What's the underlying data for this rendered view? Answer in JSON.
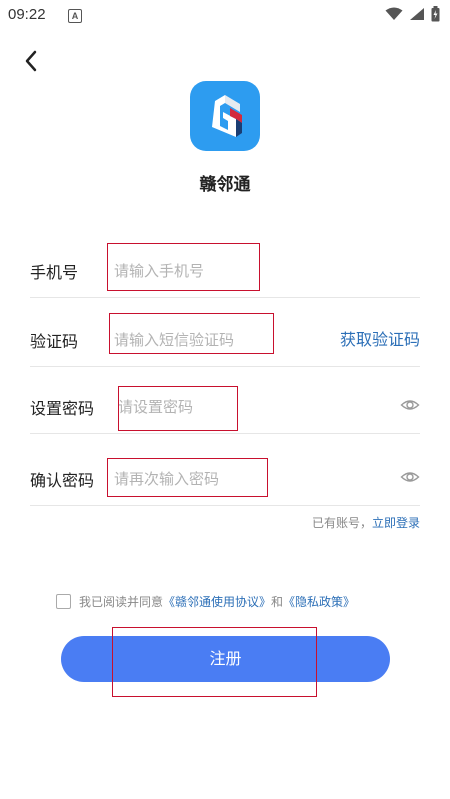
{
  "status_bar": {
    "time": "09:22",
    "notification_letter": "A"
  },
  "app": {
    "name": "赣邻通",
    "brand_color": "#2d9cf0"
  },
  "form": {
    "phone": {
      "label": "手机号",
      "placeholder": "请输入手机号",
      "value": ""
    },
    "code": {
      "label": "验证码",
      "placeholder": "请输入短信验证码",
      "value": "",
      "get_code_label": "获取验证码"
    },
    "password": {
      "label": "设置密码",
      "placeholder": "请设置密码",
      "value": ""
    },
    "confirm_password": {
      "label": "确认密码",
      "placeholder": "请再次输入密码",
      "value": ""
    }
  },
  "login_prompt": {
    "text": "已有账号，",
    "link": "立即登录"
  },
  "agreement": {
    "prefix": "我已阅读并同意",
    "terms_link": "《赣邻通使用协议》",
    "and": "和",
    "privacy_link": "《隐私政策》",
    "checked": false
  },
  "register_button": {
    "label": "注册",
    "color": "#4a7df3"
  },
  "colors": {
    "link": "#2c6fb7",
    "highlight": "#c8102e"
  },
  "icons": {
    "back": "chevron-left-icon",
    "eye": "eye-icon",
    "wifi": "wifi-icon",
    "signal": "signal-icon",
    "battery": "battery-icon"
  }
}
